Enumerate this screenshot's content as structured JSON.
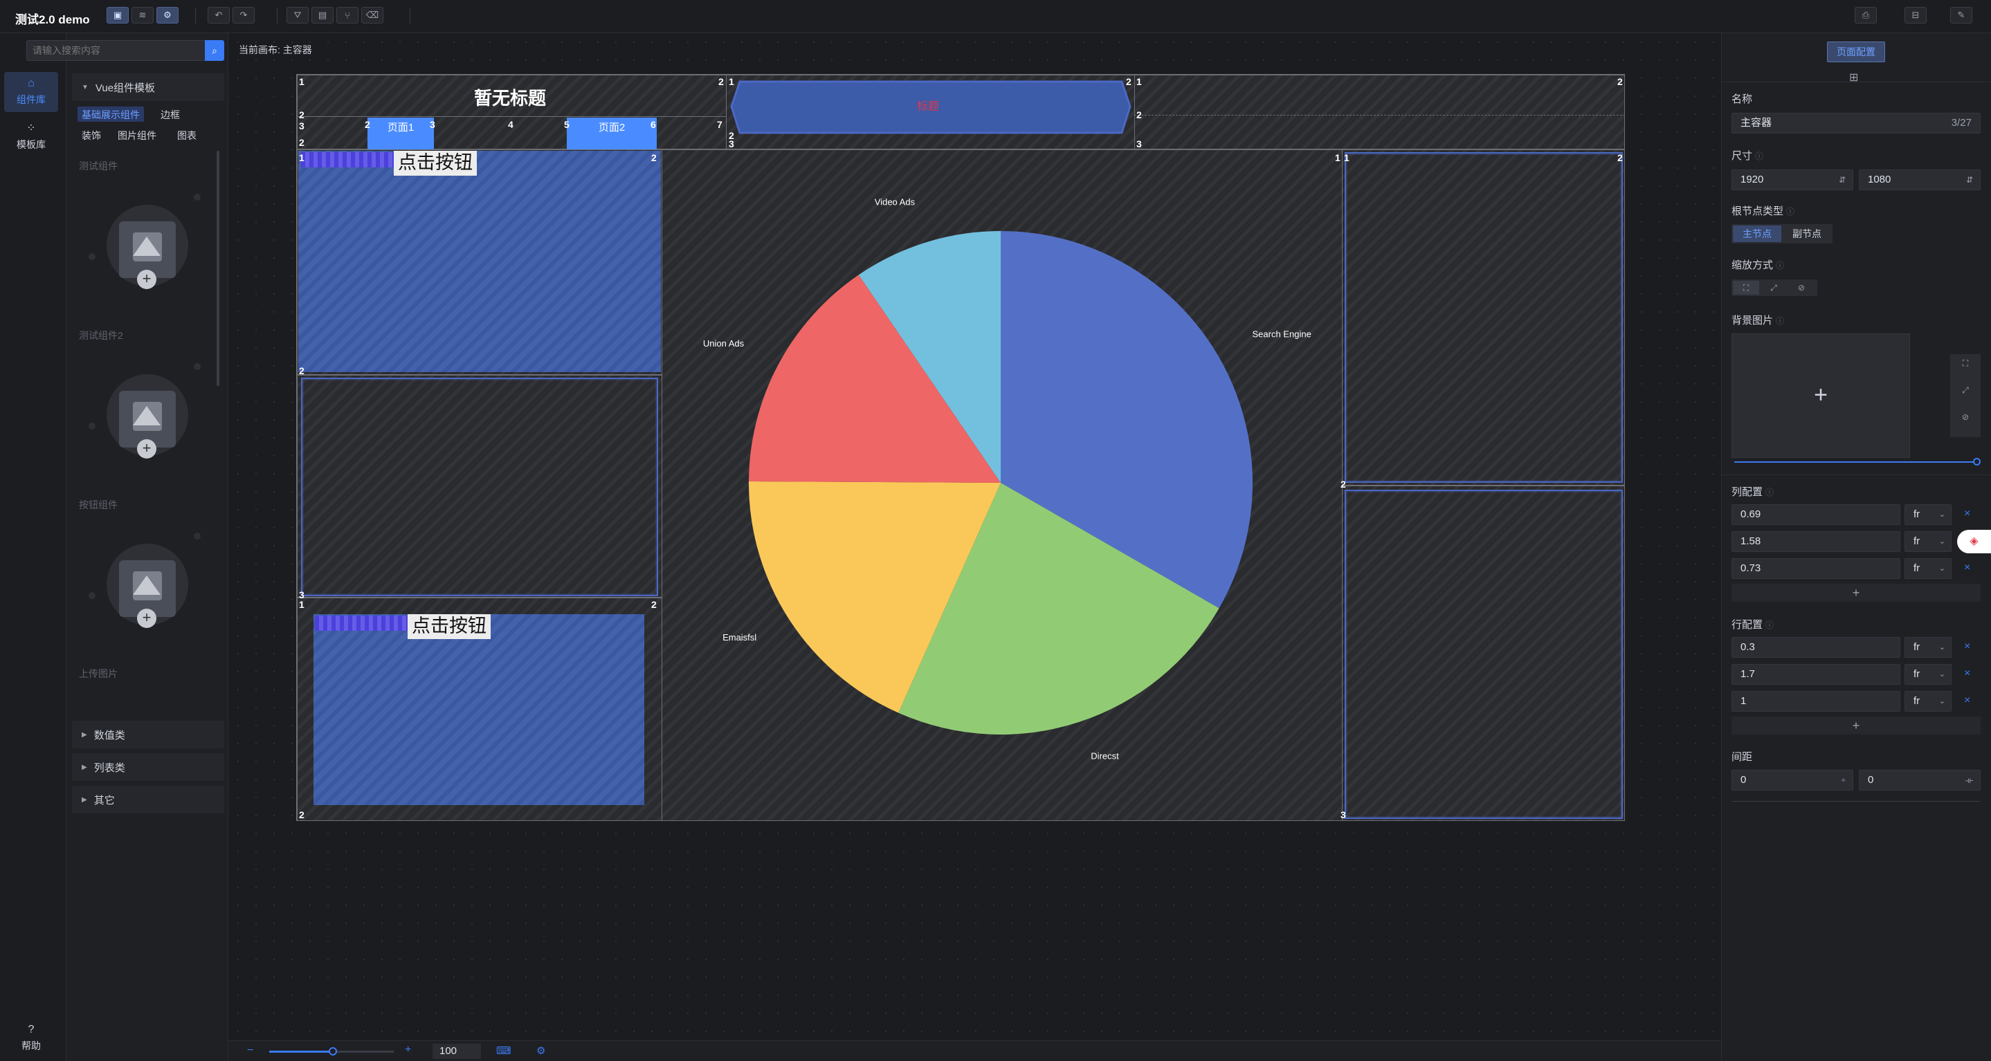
{
  "app": {
    "title": "测试2.0 demo"
  },
  "leftnav": {
    "items": [
      {
        "label": "组件库",
        "icon": "home-icon"
      },
      {
        "label": "模板库",
        "icon": "template-icon"
      }
    ],
    "help": "帮助"
  },
  "components": {
    "search_placeholder": "请输入搜索内容",
    "group_title": "Vue组件模板",
    "chips": [
      "基础展示组件",
      "边框",
      "装饰",
      "图片组件",
      "图表"
    ],
    "templates": [
      "测试组件",
      "测试组件2",
      "按钮组件",
      "上传图片"
    ],
    "sections": [
      "数值类",
      "列表类",
      "其它"
    ]
  },
  "canvas": {
    "breadcrumb": "当前画布: 主容器",
    "title": "暂无标题",
    "header_badge": "标题",
    "tabs": [
      "页面1",
      "页面2"
    ],
    "button_label": "点击按钮",
    "zoom": "100"
  },
  "numbers": {
    "n1": "1",
    "n2": "2",
    "n3": "3",
    "n4": "4",
    "n5": "5",
    "n6": "6",
    "n7": "7"
  },
  "chart_data": {
    "type": "pie",
    "title": "",
    "slices": [
      {
        "label": "Search Engine",
        "value": 1048,
        "color": "#5470c6"
      },
      {
        "label": "Direcst",
        "value": 735,
        "color": "#91cc75"
      },
      {
        "label": "Emaisfsl",
        "value": 580,
        "color": "#fac858"
      },
      {
        "label": "Union Ads",
        "value": 484,
        "color": "#ee6666"
      },
      {
        "label": "Video Ads",
        "value": 300,
        "color": "#73c0de"
      }
    ]
  },
  "config": {
    "page_config_button": "页面配置",
    "name_label": "名称",
    "name_value": "主容器",
    "name_count": "3/27",
    "size_label": "尺寸",
    "width": "1920",
    "height": "1080",
    "root_type_label": "根节点类型",
    "root_types": [
      "主节点",
      "副节点"
    ],
    "scale_label": "缩放方式",
    "bg_label": "背景图片",
    "col_label": "列配置",
    "cols": [
      "0.69",
      "1.58",
      "0.73"
    ],
    "row_label": "行配置",
    "rows": [
      "0.3",
      "1.7",
      "1"
    ],
    "unit": "fr",
    "gap_label": "间距",
    "gap_x": "0",
    "gap_y": "0"
  }
}
